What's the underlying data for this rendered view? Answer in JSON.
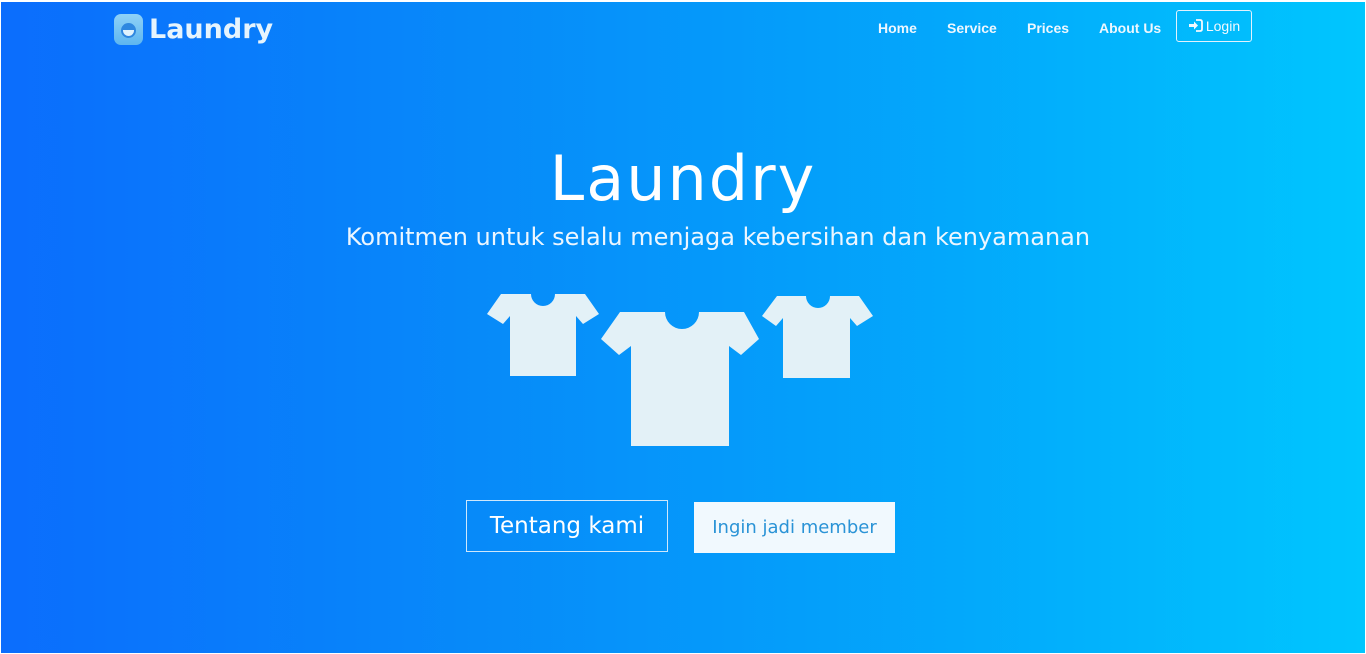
{
  "brand": {
    "name": "Laundry",
    "icon": "washing-machine-icon"
  },
  "nav": {
    "items": [
      {
        "label": "Home"
      },
      {
        "label": "Service"
      },
      {
        "label": "Prices"
      },
      {
        "label": "About Us"
      }
    ],
    "login_label": "Login",
    "login_icon": "sign-in-icon"
  },
  "hero": {
    "title": "Laundry",
    "subtitle": "Komitmen untuk selalu menjaga kebersihan dan kenyamanan",
    "illustration": "tshirts-icon",
    "primary_button": "Tentang kami",
    "secondary_button": "Ingin jadi member"
  },
  "colors": {
    "gradient_start": "#0b6dfd",
    "gradient_end": "#00c6fe",
    "shirt_fill": "#e3f1f7",
    "secondary_button_bg": "#f1f9fe",
    "secondary_button_text": "#2a93d6"
  }
}
